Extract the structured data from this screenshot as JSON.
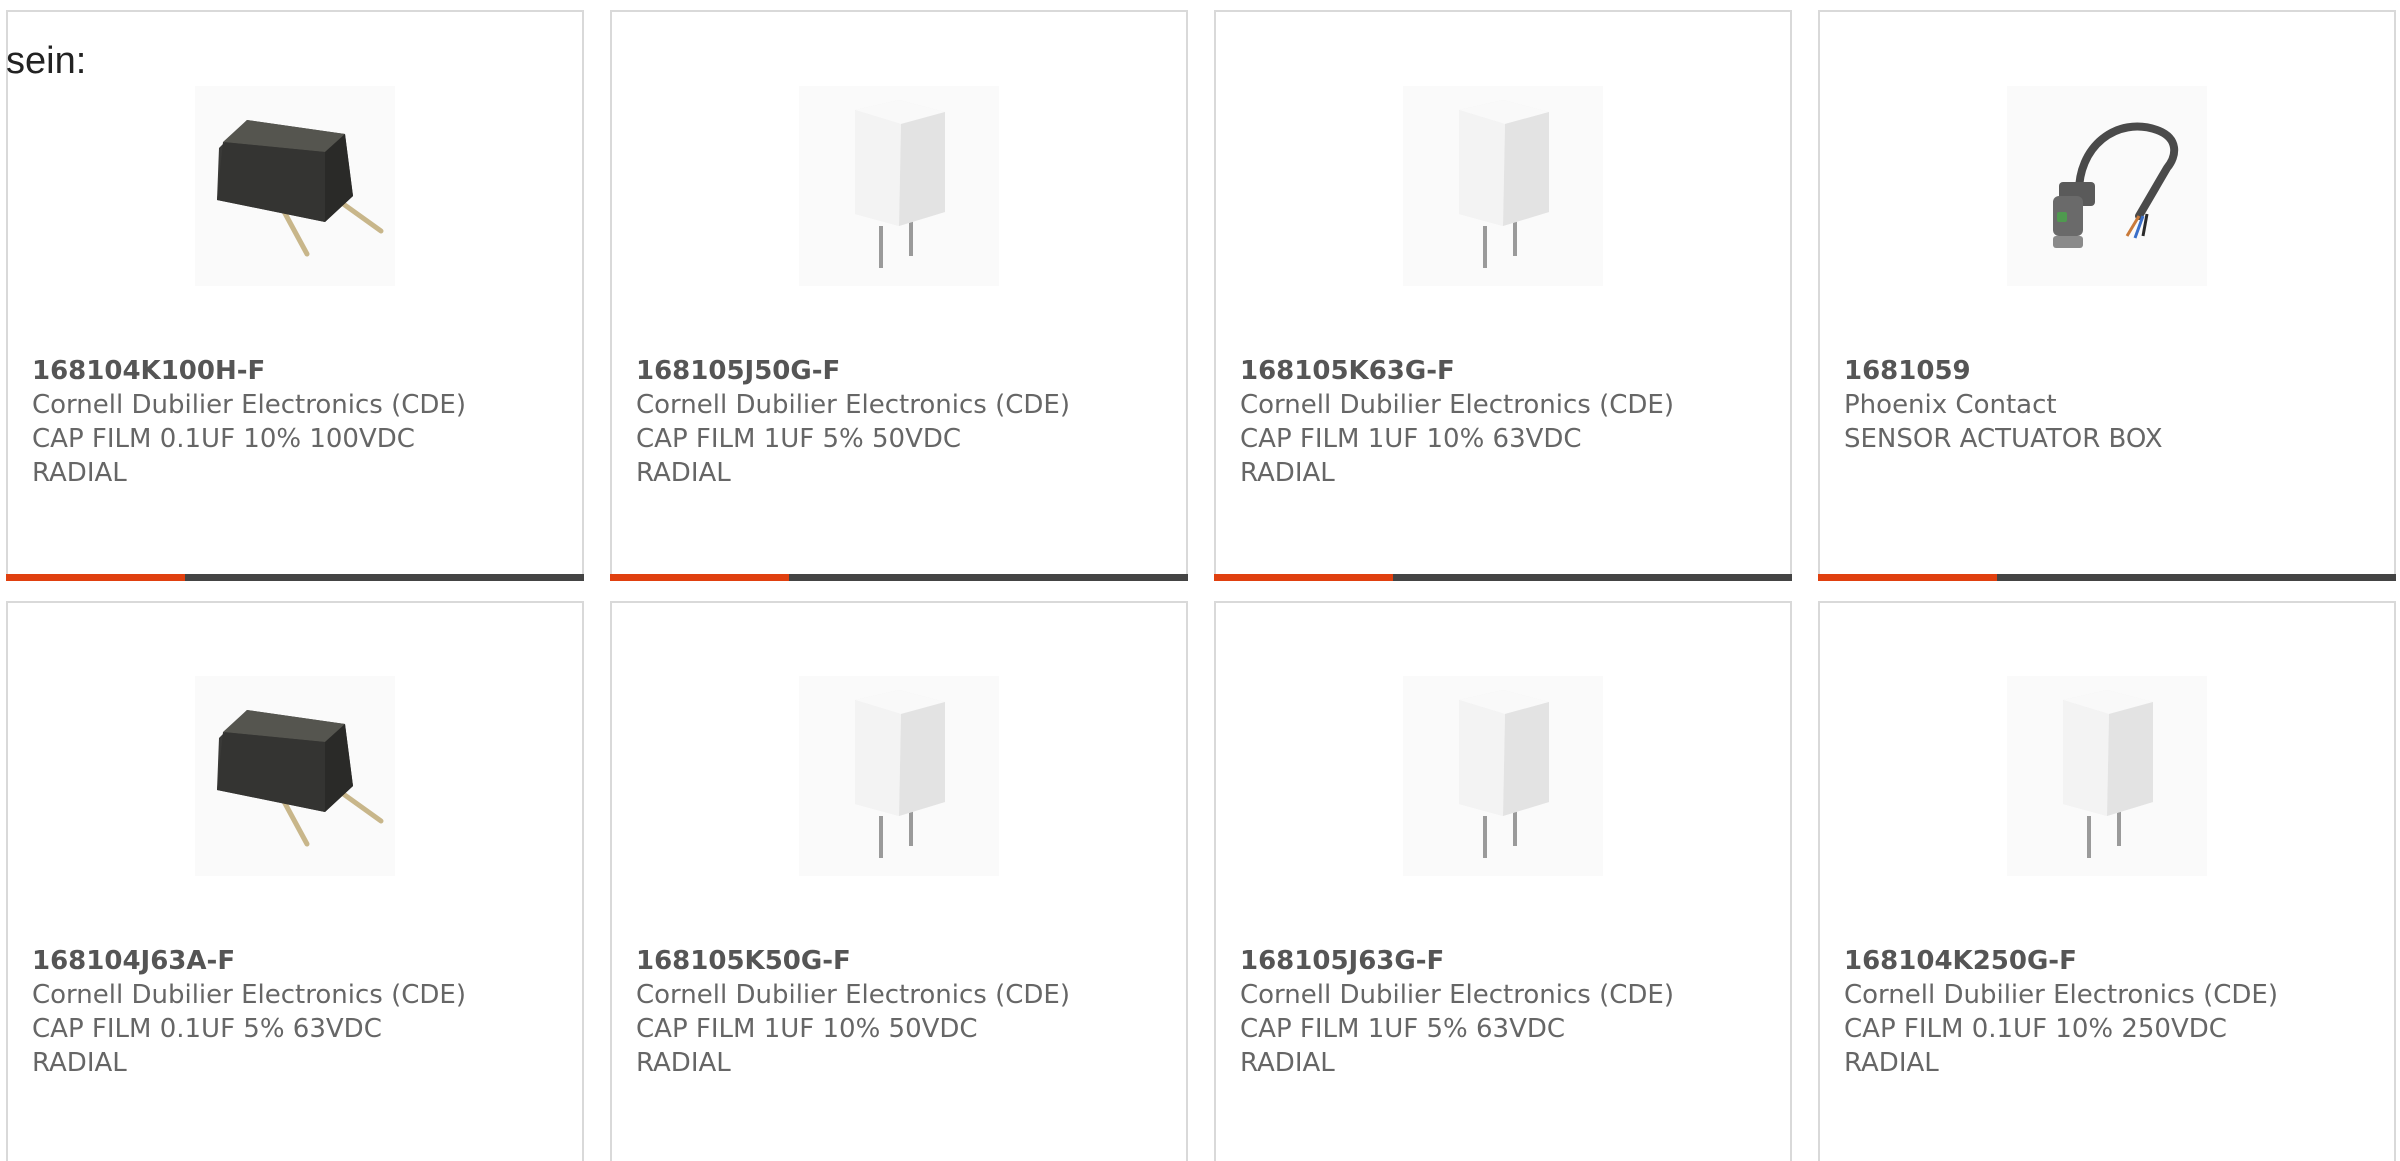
{
  "intro_text": "sein:",
  "accent_color": "#e0400f",
  "bar_color": "#444444",
  "products": [
    {
      "part_number": "168104K100H-F",
      "manufacturer": "Cornell Dubilier Electronics (CDE)",
      "desc_line1": "CAP FILM 0.1UF 10% 100VDC",
      "desc_line2": "RADIAL",
      "image": "black-film-capacitor",
      "progress": 0.31
    },
    {
      "part_number": "168105J50G-F",
      "manufacturer": "Cornell Dubilier Electronics (CDE)",
      "desc_line1": "CAP FILM 1UF 5% 50VDC",
      "desc_line2": "RADIAL",
      "image": "white-box-capacitor",
      "progress": 0.31
    },
    {
      "part_number": "168105K63G-F",
      "manufacturer": "Cornell Dubilier Electronics (CDE)",
      "desc_line1": "CAP FILM 1UF 10% 63VDC",
      "desc_line2": "RADIAL",
      "image": "white-box-capacitor",
      "progress": 0.31
    },
    {
      "part_number": "1681059",
      "manufacturer": "Phoenix Contact",
      "desc_line1": "SENSOR ACTUATOR BOX",
      "desc_line2": "",
      "image": "sensor-cable",
      "progress": 0.31
    },
    {
      "part_number": "168104J63A-F",
      "manufacturer": "Cornell Dubilier Electronics (CDE)",
      "desc_line1": "CAP FILM 0.1UF 5% 63VDC",
      "desc_line2": "RADIAL",
      "image": "black-film-capacitor",
      "progress": null
    },
    {
      "part_number": "168105K50G-F",
      "manufacturer": "Cornell Dubilier Electronics (CDE)",
      "desc_line1": "CAP FILM 1UF 10% 50VDC",
      "desc_line2": "RADIAL",
      "image": "white-box-capacitor",
      "progress": null
    },
    {
      "part_number": "168105J63G-F",
      "manufacturer": "Cornell Dubilier Electronics (CDE)",
      "desc_line1": "CAP FILM 1UF 5% 63VDC",
      "desc_line2": "RADIAL",
      "image": "white-box-capacitor",
      "progress": null
    },
    {
      "part_number": "168104K250G-F",
      "manufacturer": "Cornell Dubilier Electronics (CDE)",
      "desc_line1": "CAP FILM 0.1UF 10% 250VDC",
      "desc_line2": "RADIAL",
      "image": "white-box-capacitor",
      "progress": null
    }
  ]
}
